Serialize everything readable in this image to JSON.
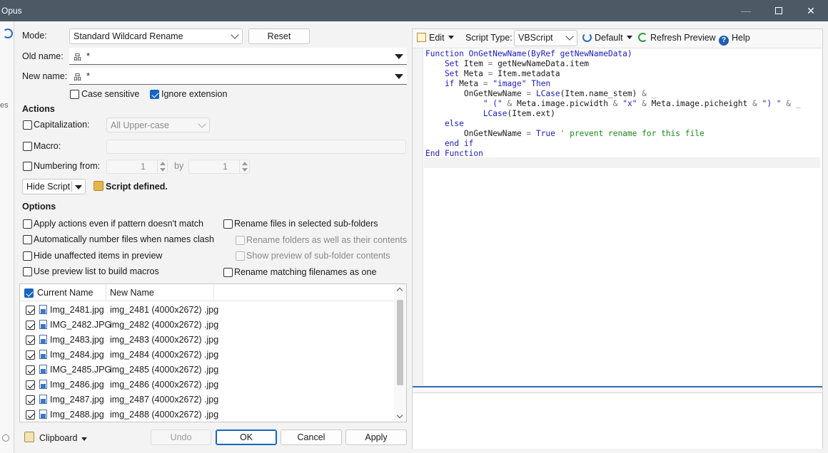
{
  "window": {
    "title": "Opus"
  },
  "left": {
    "mode_label": "Mode:",
    "mode_value": "Standard Wildcard Rename",
    "reset_label": "Reset",
    "old_name_label": "Old name:",
    "old_name_value": "*",
    "new_name_label": "New name:",
    "new_name_value": "*",
    "case_sensitive_label": "Case sensitive",
    "ignore_extension_label": "Ignore extension",
    "actions_heading": "Actions",
    "capitalization_label": "Capitalization:",
    "capitalization_value": "All Upper-case",
    "macro_label": "Macro:",
    "numbering_label": "Numbering from:",
    "numbering_from_value": "1",
    "numbering_by_label": "by",
    "numbering_by_value": "1",
    "hide_script_label": "Hide Script",
    "script_defined_label": "Script defined.",
    "options_heading": "Options",
    "opt_apply_actions": "Apply actions even if pattern doesn't match",
    "opt_auto_number": "Automatically number files when names clash",
    "opt_hide_unaffected": "Hide unaffected items in preview",
    "opt_use_preview": "Use preview list to build macros",
    "opt_rename_subfolders": "Rename files in selected sub-folders",
    "opt_rename_folders": "Rename folders as well as their contents",
    "opt_show_preview_sub": "Show preview of sub-folder contents",
    "opt_rename_matching": "Rename matching filenames as one"
  },
  "filelist": {
    "col_current": "Current Name",
    "col_new": "New Name",
    "rows": [
      {
        "current": "Img_2481.jpg",
        "new": "img_2481 (4000x2672) .jpg"
      },
      {
        "current": "IMG_2482.JPG",
        "new": "img_2482 (4000x2672) .jpg"
      },
      {
        "current": "Img_2483.jpg",
        "new": "img_2483 (4000x2672) .jpg"
      },
      {
        "current": "Img_2484.jpg",
        "new": "img_2484 (4000x2672) .jpg"
      },
      {
        "current": "IMG_2485.JPG",
        "new": "img_2485 (4000x2672) .jpg"
      },
      {
        "current": "Img_2486.jpg",
        "new": "img_2486 (4000x2672) .jpg"
      },
      {
        "current": "Img_2487.jpg",
        "new": "img_2487 (4000x2672) .jpg"
      },
      {
        "current": "Img_2488.jpg",
        "new": "img_2488 (4000x2672) .jpg"
      }
    ]
  },
  "bottom": {
    "clipboard_label": "Clipboard",
    "undo_label": "Undo",
    "ok_label": "OK",
    "cancel_label": "Cancel",
    "apply_label": "Apply"
  },
  "script": {
    "edit_label": "Edit",
    "script_type_label": "Script Type:",
    "script_type_value": "VBScript",
    "default_label": "Default",
    "refresh_label": "Refresh Preview",
    "help_label": "Help",
    "code_lines": [
      [
        {
          "t": "Function ",
          "c": "kw"
        },
        {
          "t": "OnGetNewName(ByRef getNewNameData)",
          "c": "fn"
        }
      ],
      [
        {
          "t": "    Set ",
          "c": "kw"
        },
        {
          "t": "Item ",
          "c": "id"
        },
        {
          "t": "= ",
          "c": "op"
        },
        {
          "t": "getNewNameData.item",
          "c": "id"
        }
      ],
      [
        {
          "t": "    Set ",
          "c": "kw"
        },
        {
          "t": "Meta ",
          "c": "id"
        },
        {
          "t": "= ",
          "c": "op"
        },
        {
          "t": "Item.metadata",
          "c": "id"
        }
      ],
      [
        {
          "t": "    if ",
          "c": "kw"
        },
        {
          "t": "Meta ",
          "c": "id"
        },
        {
          "t": "= ",
          "c": "op"
        },
        {
          "t": "\"image\" ",
          "c": "str"
        },
        {
          "t": "Then",
          "c": "kw"
        }
      ],
      [
        {
          "t": "        OnGetNewName ",
          "c": "id"
        },
        {
          "t": "= ",
          "c": "op"
        },
        {
          "t": "LCase",
          "c": "kw"
        },
        {
          "t": "(Item.name_stem) ",
          "c": "id"
        },
        {
          "t": "& _",
          "c": "op"
        }
      ],
      [
        {
          "t": "            \" (\" ",
          "c": "str"
        },
        {
          "t": "& ",
          "c": "op"
        },
        {
          "t": "Meta.image.picwidth ",
          "c": "id"
        },
        {
          "t": "& ",
          "c": "op"
        },
        {
          "t": "\"x\" ",
          "c": "str"
        },
        {
          "t": "& ",
          "c": "op"
        },
        {
          "t": "Meta.image.picheight ",
          "c": "id"
        },
        {
          "t": "& ",
          "c": "op"
        },
        {
          "t": "\") \" ",
          "c": "str"
        },
        {
          "t": "& _",
          "c": "op"
        }
      ],
      [
        {
          "t": "            LCase",
          "c": "kw"
        },
        {
          "t": "(Item.ext)",
          "c": "id"
        }
      ],
      [
        {
          "t": "    else",
          "c": "kw"
        }
      ],
      [
        {
          "t": "        OnGetNewName ",
          "c": "id"
        },
        {
          "t": "= ",
          "c": "op"
        },
        {
          "t": "True ",
          "c": "kw"
        },
        {
          "t": "' prevent rename for this file",
          "c": "cm"
        }
      ],
      [
        {
          "t": "    end if",
          "c": "kw"
        }
      ],
      [
        {
          "t": "End Function",
          "c": "kw"
        }
      ]
    ]
  }
}
